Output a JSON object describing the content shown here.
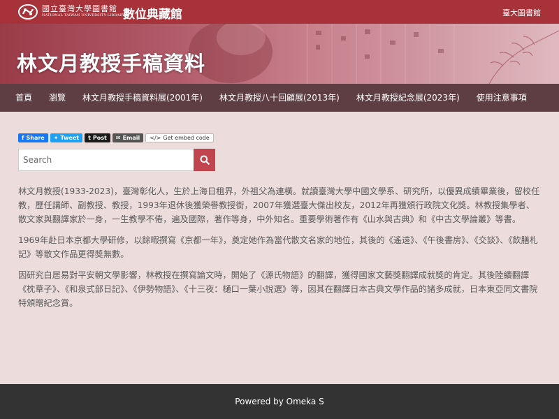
{
  "header": {
    "logo_cn": "國立臺灣大學圖書館",
    "logo_en": "NATIONAL TAIWAN UNIVERSITY LIBRARY",
    "site_name": "數位典藏館",
    "top_link": "臺大圖書館"
  },
  "banner": {
    "title": "林文月教授手稿資料"
  },
  "nav": {
    "items": [
      "首頁",
      "瀏覽",
      "林文月教授手稿資料展(2001年)",
      "林文月教授八十回顧展(2013年)",
      "林文月教授紀念展(2023年)",
      "使用注意事項"
    ]
  },
  "share": {
    "facebook": "Share",
    "twitter": "Tweet",
    "tumblr": "Post",
    "email": "Email",
    "embed": "Get embed code"
  },
  "search": {
    "placeholder": "Search"
  },
  "content": {
    "paragraphs": [
      "林文月教授(1933-2023)，臺灣彰化人，生於上海日租界，外祖父為連橫。就讀臺灣大學中國文學系、研究所，以優異成績畢業後，留校任教，歷任講師、副教授、教授，1993年退休後獲榮譽教授銜，2007年獲選臺大傑出校友，2012年再獲頒行政院文化獎。林教授集學者、散文家與翻譯家於一身，一生教學不倦，遍及國際，著作等身，中外知名。重要學術著作有《山水與古典》和《中古文學論叢》等書。",
      "1969年赴日本京都大學研修，以餘暇撰寫《京都一年》，奠定她作為當代散文名家的地位，其後的《遙遠》、《午後書房》、《交談》、《飲膳札記》等散文作品更得獎無數。",
      "因研究白居易對平安朝文學影響，林教授在撰寫論文時，開始了《源氏物語》的翻譯，獲得國家文藝獎翻譯成就獎的肯定。其後陸續翻譯《枕草子》、《和泉式部日記》、《伊勢物語》、《十三夜：樋口一葉小說選》等，因其在翻譯日本古典文學作品的諸多成就，日本東亞同文書院特頒贈紀念賞。"
    ]
  },
  "footer": {
    "text": "Powered by Omeka S"
  },
  "colors": {
    "topbar": "#a8323a",
    "nav": "#5e3e43",
    "page_bg": "#ecdcdc",
    "search_button": "#c0454e",
    "footer": "#333333"
  }
}
